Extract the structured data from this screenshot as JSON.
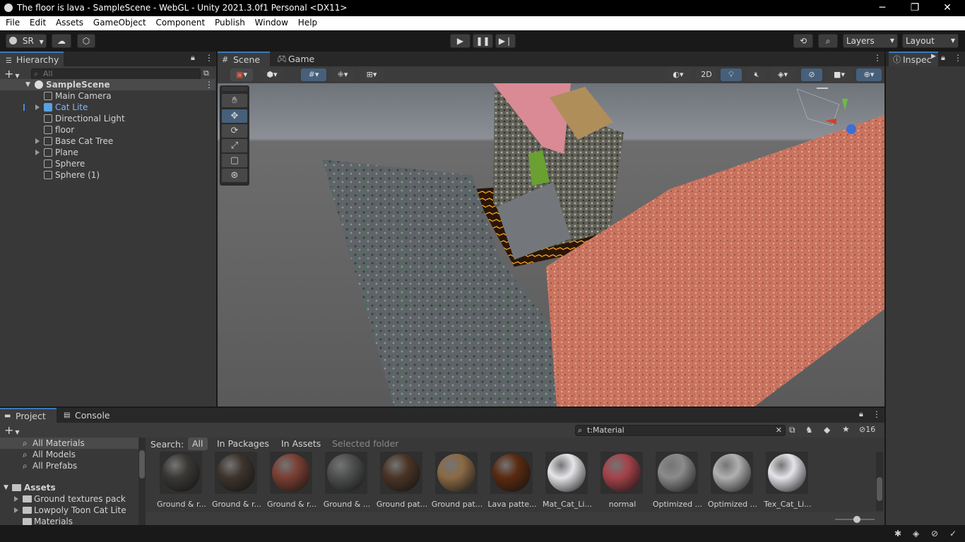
{
  "window": {
    "title": "The floor is lava - SampleScene - WebGL - Unity 2021.3.0f1 Personal <DX11>"
  },
  "menu": [
    "File",
    "Edit",
    "Assets",
    "GameObject",
    "Component",
    "Publish",
    "Window",
    "Help"
  ],
  "toolbar": {
    "account": "SR",
    "layers_label": "Layers",
    "layout_label": "Layout"
  },
  "hierarchy": {
    "tab": "Hierarchy",
    "search_placeholder": "All",
    "scene": "SampleScene",
    "items": [
      {
        "label": "Main Camera",
        "expandable": false,
        "selected": false
      },
      {
        "label": "Cat Lite",
        "expandable": true,
        "selected": true
      },
      {
        "label": "Directional Light",
        "expandable": false,
        "selected": false
      },
      {
        "label": "floor",
        "expandable": false,
        "selected": false
      },
      {
        "label": "Base Cat Tree",
        "expandable": true,
        "selected": false
      },
      {
        "label": "Plane",
        "expandable": true,
        "selected": false
      },
      {
        "label": "Sphere",
        "expandable": false,
        "selected": false
      },
      {
        "label": "Sphere (1)",
        "expandable": false,
        "selected": false
      }
    ]
  },
  "scene_view": {
    "tab_scene": "Scene",
    "tab_game": "Game",
    "mode_2d": "2D"
  },
  "inspector": {
    "tab": "Inspec"
  },
  "project": {
    "tab_project": "Project",
    "tab_console": "Console",
    "search_value": "t:Material",
    "hidden_count": "16",
    "search_label": "Search:",
    "filters": [
      "All",
      "In Packages",
      "In Assets",
      "Selected folder"
    ],
    "favorites": [
      "All Materials",
      "All Models",
      "All Prefabs"
    ],
    "assets_root": "Assets",
    "folders": [
      "Ground textures pack",
      "Lowpoly Toon Cat Lite",
      "Materials"
    ],
    "materials": [
      {
        "label": "Ground & r...",
        "color": "#3a3835"
      },
      {
        "label": "Ground & r...",
        "color": "#3d342c"
      },
      {
        "label": "Ground & r...",
        "color": "#7a3e32"
      },
      {
        "label": "Ground & ...",
        "color": "#4d4f4e"
      },
      {
        "label": "Ground pat...",
        "color": "#4a3426"
      },
      {
        "label": "Ground pat...",
        "color": "#8a6a45"
      },
      {
        "label": "Lava patte...",
        "color": "#5a2a10"
      },
      {
        "label": "Mat_Cat_Li...",
        "color": "#e6e6ea"
      },
      {
        "label": "normal",
        "color": "#a5424a"
      },
      {
        "label": "Optimized ...",
        "color": "#8b8b8b"
      },
      {
        "label": "Optimized ...",
        "color": "#b0b0b0"
      },
      {
        "label": "Tex_Cat_Li...",
        "color": "#e4e4ea"
      }
    ]
  }
}
